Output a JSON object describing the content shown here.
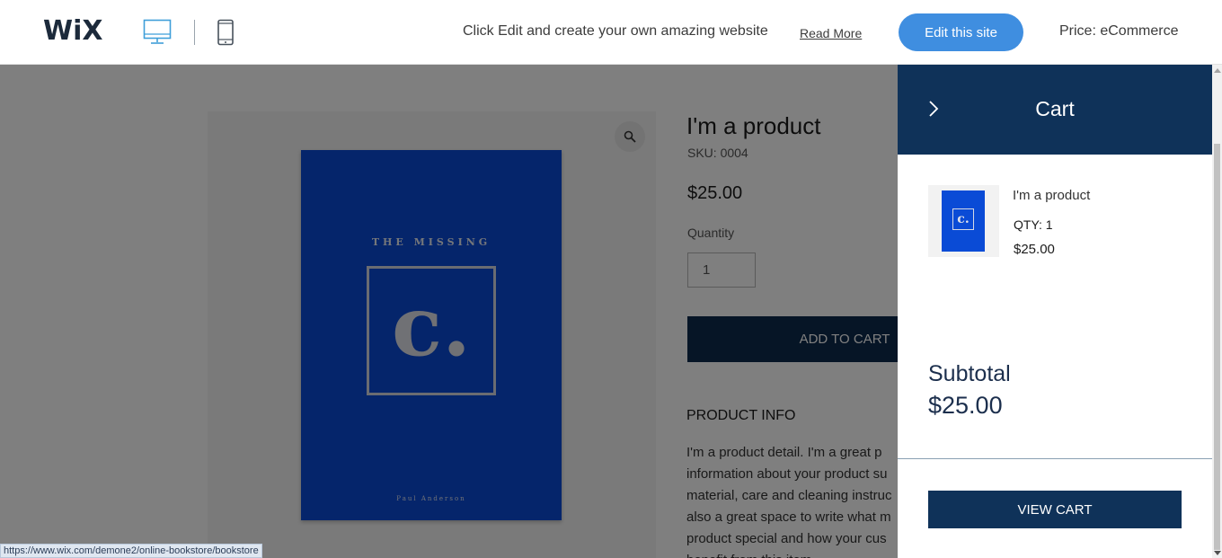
{
  "topbar": {
    "logo_text": "WiX",
    "device_desktop_icon": "desktop-icon",
    "device_mobile_icon": "mobile-icon",
    "promo_text": "Click Edit and create your own amazing website",
    "read_more": "Read More",
    "edit_button": "Edit this site",
    "price_text": "Price: eCommerce",
    "accent_color": "#3f8ee0"
  },
  "product": {
    "zoom_icon": "magnifier-icon",
    "book": {
      "title": "THE MISSING",
      "letter": "c.",
      "author": "Paul Anderson",
      "cover_color": "#0a4bd6"
    },
    "name": "I'm a product",
    "sku": "SKU: 0004",
    "price": "$25.00",
    "quantity_label": "Quantity",
    "quantity_value": "1",
    "add_to_cart": "ADD TO CART",
    "info_heading": "PRODUCT INFO",
    "info_lines": [
      "I'm a product detail. I'm a great p",
      "information about your product su",
      "material, care and cleaning instruc",
      "also a great space to write what m",
      "product special and how your cus",
      "benefit from this item."
    ]
  },
  "cart": {
    "title": "Cart",
    "close_icon": "chevron-right-icon",
    "header_color": "#0f3259",
    "item": {
      "name": "I'm a product",
      "qty": "QTY: 1",
      "price": "$25.00"
    },
    "subtotal_label": "Subtotal",
    "subtotal_value": "$25.00",
    "view_cart": "VIEW CART"
  },
  "statusbar": {
    "url": "https://www.wix.com/demone2/online-bookstore/bookstore"
  }
}
